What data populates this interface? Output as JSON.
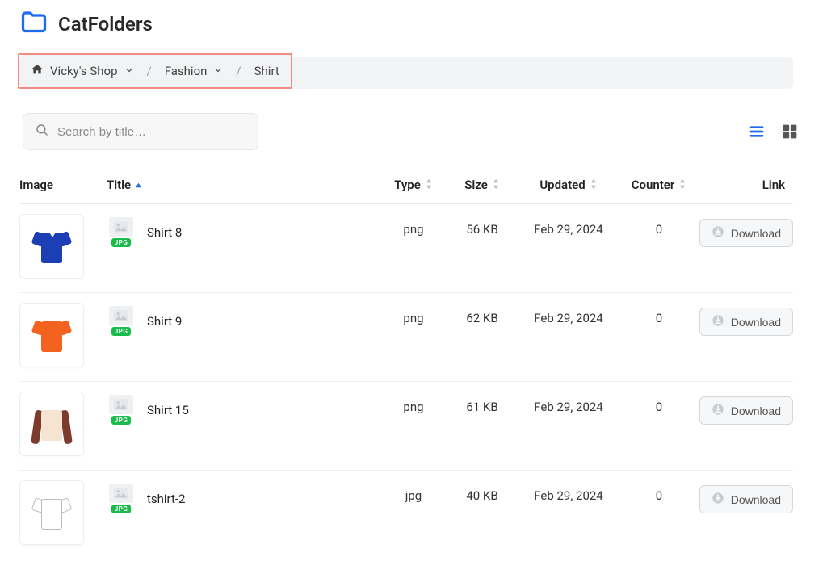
{
  "brand": "CatFolders",
  "breadcrumb": {
    "root": "Vicky's Shop",
    "mid": "Fashion",
    "leaf": "Shirt"
  },
  "search": {
    "placeholder": "Search by title…"
  },
  "columns": {
    "image": "Image",
    "title": "Title",
    "type": "Type",
    "size": "Size",
    "updated": "Updated",
    "counter": "Counter",
    "link": "Link"
  },
  "download_label": "Download",
  "file_tag": "JPG",
  "rows": [
    {
      "title": "Shirt 8",
      "type": "png",
      "size": "56 KB",
      "updated": "Feb 29, 2024",
      "counter": "0",
      "thumb": "blue-v"
    },
    {
      "title": "Shirt 9",
      "type": "png",
      "size": "62 KB",
      "updated": "Feb 29, 2024",
      "counter": "0",
      "thumb": "orange"
    },
    {
      "title": "Shirt 15",
      "type": "png",
      "size": "61 KB",
      "updated": "Feb 29, 2024",
      "counter": "0",
      "thumb": "longsleeve"
    },
    {
      "title": "tshirt-2",
      "type": "jpg",
      "size": "40 KB",
      "updated": "Feb 29, 2024",
      "counter": "0",
      "thumb": "outline"
    }
  ],
  "colors": {
    "accent": "#1e6bf1",
    "blue_shirt": "#1c3fb5",
    "orange_shirt": "#f4621f",
    "long_body": "#f4e4d0",
    "long_sleeve": "#7d3b2e"
  }
}
